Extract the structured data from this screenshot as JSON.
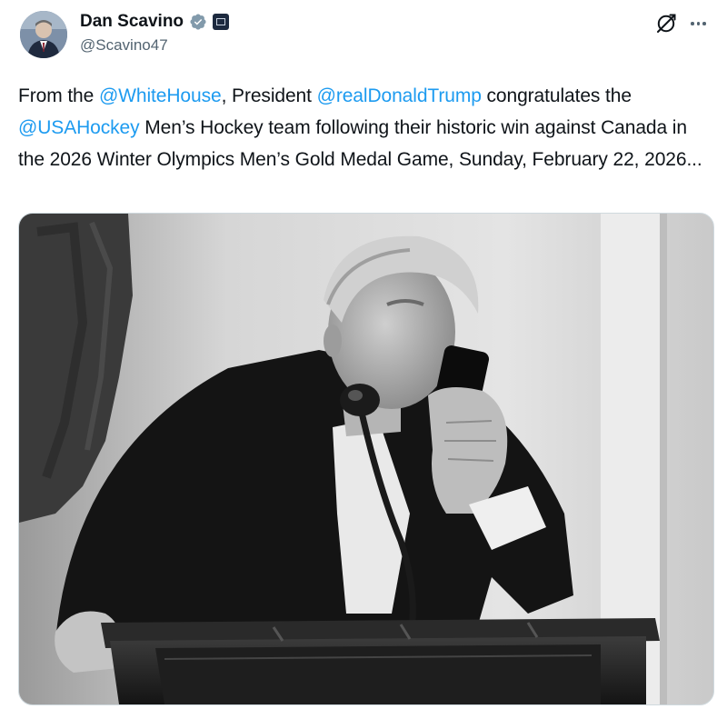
{
  "author": {
    "display_name": "Dan Scavino",
    "handle": "@Scavino47"
  },
  "icons": {
    "verified": "verified-badge-icon",
    "affiliate": "affiliate-badge-icon",
    "grok": "grok-icon",
    "more": "more-options-icon"
  },
  "tweet": {
    "segments": [
      {
        "text": "From the ",
        "type": "text"
      },
      {
        "text": "@WhiteHouse",
        "type": "mention"
      },
      {
        "text": ", President ",
        "type": "text"
      },
      {
        "text": "@realDonaldTrump",
        "type": "mention"
      },
      {
        "text": " congratulates the ",
        "type": "text"
      },
      {
        "text": "@USAHockey",
        "type": "mention"
      },
      {
        "text": " Men’s Hockey team following their historic win against Canada in the 2026 Winter Olympics Men’s Gold Medal Game, Sunday, February 22, 2026...",
        "type": "text"
      }
    ]
  },
  "colors": {
    "text": "#0f1419",
    "secondary": "#536471",
    "link": "#1d9bf0",
    "verified": "#829aab"
  }
}
